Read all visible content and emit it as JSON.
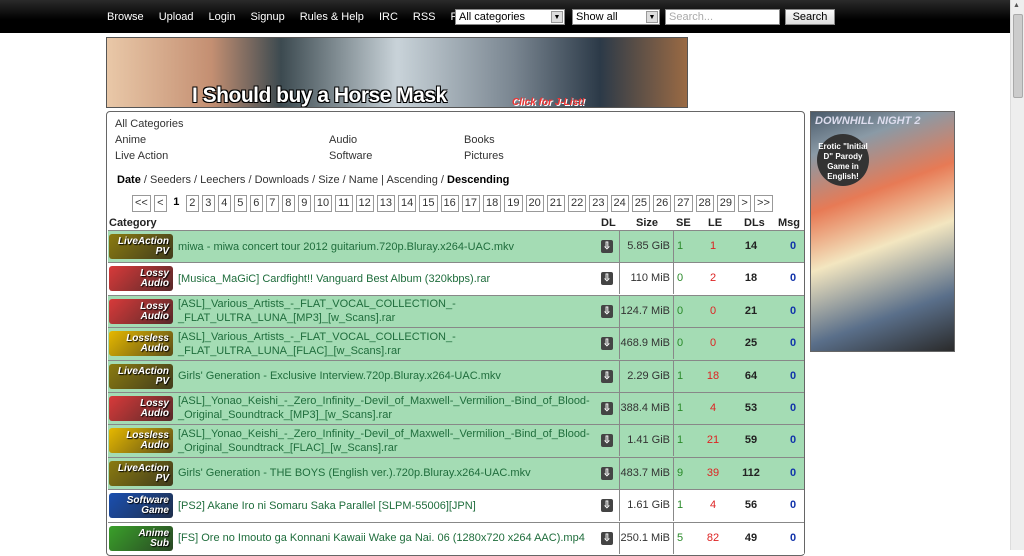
{
  "nav": {
    "items": [
      "Browse",
      "Upload",
      "Login",
      "Signup",
      "Rules & Help",
      "IRC",
      "RSS",
      "Fap"
    ],
    "category_select": "All categories",
    "filter_select": "Show all",
    "search_placeholder": "Search...",
    "search_button": "Search"
  },
  "banner": {
    "text": "I Should buy a Horse Mask",
    "link": "Click for J-List!"
  },
  "categories": {
    "all": "All Categories",
    "items": [
      "Anime",
      "Audio",
      "Books",
      "Live Action",
      "Software",
      "Pictures"
    ]
  },
  "sort": {
    "options": [
      "Date",
      "Seeders",
      "Leechers",
      "Downloads",
      "Size",
      "Name"
    ],
    "order": [
      "Ascending",
      "Descending"
    ],
    "active": [
      "Date",
      "Descending"
    ]
  },
  "pager": {
    "first": "<<",
    "prev": "<",
    "current": "1",
    "pages": [
      "2",
      "3",
      "4",
      "5",
      "6",
      "7",
      "8",
      "9",
      "10",
      "11",
      "12",
      "13",
      "14",
      "15",
      "16",
      "17",
      "18",
      "19",
      "20",
      "21",
      "22",
      "23",
      "24",
      "25",
      "26",
      "27",
      "28",
      "29"
    ],
    "next": ">",
    "last": ">>"
  },
  "table": {
    "headers": {
      "category": "Category",
      "dl": "DL",
      "size": "Size",
      "se": "SE",
      "le": "LE",
      "dls": "DLs",
      "msg": "Msg"
    },
    "rows": [
      {
        "cat": [
          "LiveAction",
          "PV"
        ],
        "color": "#8a7a10",
        "name": "miwa - miwa concert tour 2012 guitarium.720p.Bluray.x264-UAC.mkv",
        "size": "5.85 GiB",
        "se": "1",
        "le": "1",
        "dls": "14",
        "msg": "0",
        "hl": true
      },
      {
        "cat": [
          "Lossy",
          "Audio"
        ],
        "color": "#d83a3a",
        "name": "[Musica_MaGiC] Cardfight!! Vanguard Best Album (320kbps).rar",
        "size": "110 MiB",
        "se": "0",
        "le": "2",
        "dls": "18",
        "msg": "0",
        "hl": false
      },
      {
        "cat": [
          "Lossy",
          "Audio"
        ],
        "color": "#d83a3a",
        "name": "[ASL]_Various_Artists_-_FLAT_VOCAL_COLLECTION_-_FLAT_ULTRA_LUNA_[MP3]_[w_Scans].rar",
        "size": "124.7 MiB",
        "se": "0",
        "le": "0",
        "dls": "21",
        "msg": "0",
        "hl": true
      },
      {
        "cat": [
          "Lossless",
          "Audio"
        ],
        "color": "#e6b800",
        "name": "[ASL]_Various_Artists_-_FLAT_VOCAL_COLLECTION_-_FLAT_ULTRA_LUNA_[FLAC]_[w_Scans].rar",
        "size": "468.9 MiB",
        "se": "0",
        "le": "0",
        "dls": "25",
        "msg": "0",
        "hl": true
      },
      {
        "cat": [
          "LiveAction",
          "PV"
        ],
        "color": "#8a7a10",
        "name": "Girls' Generation - Exclusive Interview.720p.Bluray.x264-UAC.mkv",
        "size": "2.29 GiB",
        "se": "1",
        "le": "18",
        "dls": "64",
        "msg": "0",
        "hl": true
      },
      {
        "cat": [
          "Lossy",
          "Audio"
        ],
        "color": "#d83a3a",
        "name": "[ASL]_Yonao_Keishi_-_Zero_Infinity_-Devil_of_Maxwell-_Vermilion_-Bind_of_Blood-_Original_Soundtrack_[MP3]_[w_Scans].rar",
        "size": "388.4 MiB",
        "se": "1",
        "le": "4",
        "dls": "53",
        "msg": "0",
        "hl": true
      },
      {
        "cat": [
          "Lossless",
          "Audio"
        ],
        "color": "#e6b800",
        "name": "[ASL]_Yonao_Keishi_-_Zero_Infinity_-Devil_of_Maxwell-_Vermilion_-Bind_of_Blood-_Original_Soundtrack_[FLAC]_[w_Scans].rar",
        "size": "1.41 GiB",
        "se": "1",
        "le": "21",
        "dls": "59",
        "msg": "0",
        "hl": true
      },
      {
        "cat": [
          "LiveAction",
          "PV"
        ],
        "color": "#8a7a10",
        "name": "Girls' Generation - THE BOYS (English ver.).720p.Bluray.x264-UAC.mkv",
        "size": "483.7 MiB",
        "se": "9",
        "le": "39",
        "dls": "112",
        "msg": "0",
        "hl": true
      },
      {
        "cat": [
          "Software",
          "Game"
        ],
        "color": "#1a4fb0",
        "name": "[PS2] Akane Iro ni Somaru Saka Parallel [SLPM-55006][JPN]",
        "size": "1.61 GiB",
        "se": "1",
        "le": "4",
        "dls": "56",
        "msg": "0",
        "hl": false
      },
      {
        "cat": [
          "Anime",
          "Sub"
        ],
        "color": "#3aa02a",
        "name": "[FS] Ore no Imouto ga Konnani Kawaii Wake ga Nai. 06 (1280x720 x264 AAC).mp4",
        "size": "250.1 MiB",
        "se": "5",
        "le": "82",
        "dls": "49",
        "msg": "0",
        "hl": false
      }
    ]
  },
  "ad": {
    "title": "DOWNHILL NIGHT 2",
    "badge": "Erotic \"Initial D\" Parody Game in English!"
  }
}
